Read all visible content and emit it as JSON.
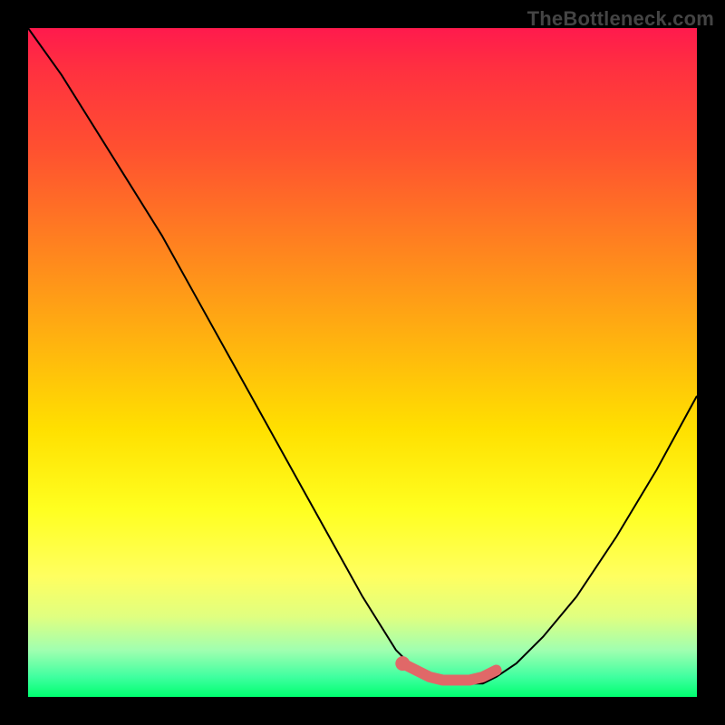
{
  "watermark": "TheBottleneck.com",
  "colors": {
    "background": "#000000",
    "curve": "#000000",
    "marker": "#e06868",
    "gradient_top": "#ff1a4d",
    "gradient_bottom": "#00ff70"
  },
  "chart_data": {
    "type": "line",
    "title": "",
    "xlabel": "",
    "ylabel": "",
    "xlim": [
      0,
      100
    ],
    "ylim": [
      0,
      100
    ],
    "series": [
      {
        "name": "bottleneck-curve",
        "x": [
          0,
          5,
          10,
          15,
          20,
          25,
          30,
          35,
          40,
          45,
          50,
          55,
          58,
          60,
          62,
          65,
          68,
          70,
          73,
          77,
          82,
          88,
          94,
          100
        ],
        "values": [
          100,
          93,
          85,
          77,
          69,
          60,
          51,
          42,
          33,
          24,
          15,
          7,
          4,
          3,
          2,
          2,
          2,
          3,
          5,
          9,
          15,
          24,
          34,
          45
        ]
      },
      {
        "name": "highlight-segment",
        "x": [
          56,
          58,
          60,
          62,
          64,
          66,
          68,
          70
        ],
        "values": [
          5,
          4,
          3,
          2.5,
          2.5,
          2.5,
          3,
          4
        ]
      }
    ]
  }
}
